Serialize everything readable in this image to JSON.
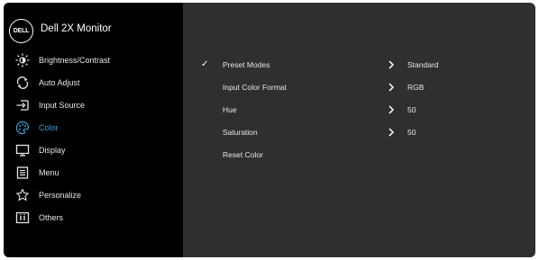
{
  "header": {
    "logo_text": "DELL",
    "title": "Dell 2X Monitor"
  },
  "sidebar": {
    "items": [
      {
        "label": "Brightness/Contrast",
        "icon": "brightness-icon"
      },
      {
        "label": "Auto Adjust",
        "icon": "auto-adjust-icon"
      },
      {
        "label": "Input Source",
        "icon": "input-source-icon"
      },
      {
        "label": "Color",
        "icon": "color-palette-icon",
        "active": true
      },
      {
        "label": "Display",
        "icon": "display-icon"
      },
      {
        "label": "Menu",
        "icon": "menu-icon"
      },
      {
        "label": "Personalize",
        "icon": "star-icon"
      },
      {
        "label": "Others",
        "icon": "info-icon"
      }
    ]
  },
  "color_menu": {
    "rows": [
      {
        "label": "Preset Modes",
        "value": "Standard",
        "checked": true,
        "has_arrow": true
      },
      {
        "label": "Input Color Format",
        "value": "RGB",
        "has_arrow": true
      },
      {
        "label": "Hue",
        "value": "50",
        "has_arrow": true
      },
      {
        "label": "Saturation",
        "value": "50",
        "has_arrow": true
      },
      {
        "label": "Reset Color",
        "value": ""
      }
    ],
    "check_glyph": "✓"
  },
  "colors": {
    "sidebar_bg": "#000000",
    "panel_bg": "#2f2f2f",
    "accent": "#3a9fd6",
    "text": "#e6e6e6"
  }
}
